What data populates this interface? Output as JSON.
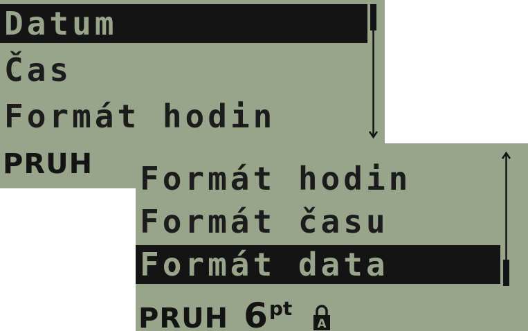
{
  "screen_top": {
    "menu": [
      {
        "label": "Datum",
        "selected": true
      },
      {
        "label": "Čas",
        "selected": false
      },
      {
        "label": "Formát hodin",
        "selected": false
      }
    ],
    "status": {
      "mode": "PRUH",
      "size": "",
      "unit": ""
    }
  },
  "screen_bottom": {
    "menu": [
      {
        "label": "Formát hodin",
        "selected": false
      },
      {
        "label": "Formát času",
        "selected": false
      },
      {
        "label": "Formát data",
        "selected": true
      }
    ],
    "status": {
      "mode": "PRUH",
      "size": "6",
      "unit": "pt",
      "lock_letter": "A"
    }
  },
  "colors": {
    "lcd_background": "#98a58b",
    "lcd_text": "#1c1c1c",
    "selection_bar": "#141414"
  }
}
